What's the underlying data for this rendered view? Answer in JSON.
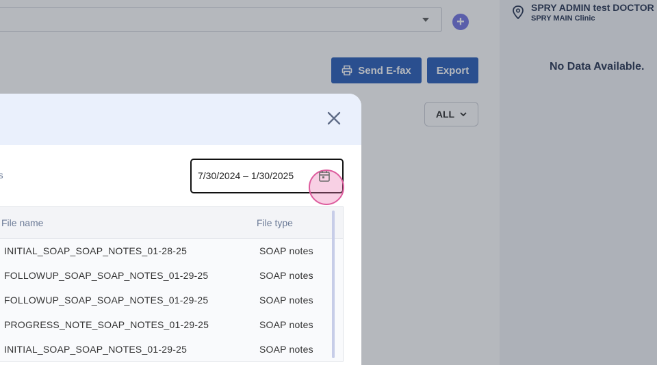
{
  "header": {
    "send_efax_label": "Send E-fax",
    "export_label": "Export",
    "filter_label": "ALL"
  },
  "sidebar": {
    "doctor_name": "SPRY ADMIN test DOCTOR",
    "clinic_name": "SPRY MAIN Clinic",
    "empty_message": "No Data Available."
  },
  "modal": {
    "filter_label_fragment": "nts",
    "date_range": "7/30/2024 – 1/30/2025",
    "columns": [
      "File name",
      "File type"
    ],
    "rows": [
      {
        "name": "INITIAL_SOAP_SOAP_NOTES_01-28-25",
        "type": "SOAP notes"
      },
      {
        "name": "FOLLOWUP_SOAP_SOAP_NOTES_01-29-25",
        "type": "SOAP notes"
      },
      {
        "name": "FOLLOWUP_SOAP_SOAP_NOTES_01-29-25",
        "type": "SOAP notes"
      },
      {
        "name": "PROGRESS_NOTE_SOAP_NOTES_01-29-25",
        "type": "SOAP notes"
      },
      {
        "name": "INITIAL_SOAP_SOAP_NOTES_01-29-25",
        "type": "SOAP notes"
      }
    ]
  },
  "colors": {
    "primary": "#1f56b5",
    "add_button": "#6c6fe0",
    "modal_header": "#eaf0fc",
    "highlight": "#dd5b9d"
  },
  "icons": [
    "chevron-down-icon",
    "plus-icon",
    "printer-icon",
    "location-pin-icon",
    "close-icon",
    "calendar-icon"
  ]
}
